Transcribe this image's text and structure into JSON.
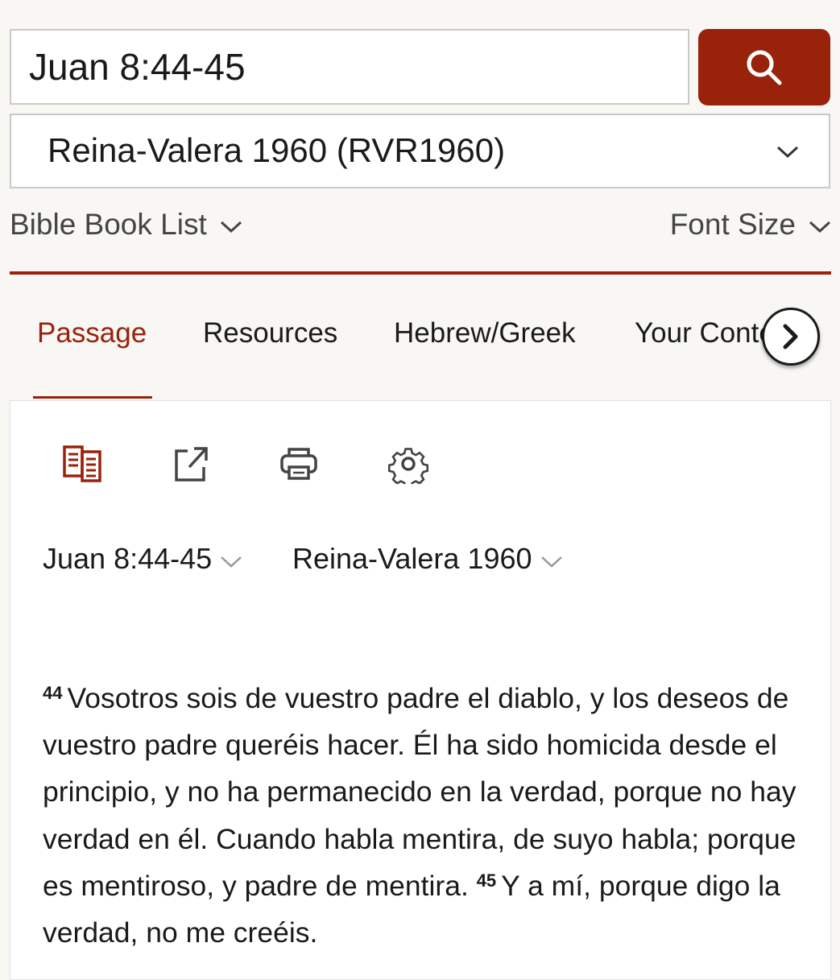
{
  "search": {
    "value": "Juan 8:44-45"
  },
  "version_select": {
    "selected": "Reina-Valera 1960 (RVR1960)"
  },
  "subnav": {
    "book_list": "Bible Book List",
    "font_size": "Font Size"
  },
  "tabs": [
    {
      "label": "Passage",
      "active": true
    },
    {
      "label": "Resources"
    },
    {
      "label": "Hebrew/Greek"
    },
    {
      "label": "Your Content"
    }
  ],
  "toolbar": [
    "parallel-view-icon",
    "share-icon",
    "print-icon",
    "settings-icon"
  ],
  "reference": {
    "passage": "Juan 8:44-45",
    "version": "Reina-Valera 1960"
  },
  "verses": [
    {
      "num": "44",
      "text": "Vosotros sois de vuestro padre el diablo, y los deseos de vuestro padre queréis hacer. Él ha sido homicida desde el principio, y no ha permanecido en la verdad, porque no hay verdad en él. Cuando habla mentira, de suyo habla; porque es mentiroso, y padre de mentira."
    },
    {
      "num": "45",
      "text": "Y a mí, porque digo la verdad, no me creéis."
    }
  ],
  "colors": {
    "accent": "#99220b",
    "background": "#f8f7f4"
  }
}
